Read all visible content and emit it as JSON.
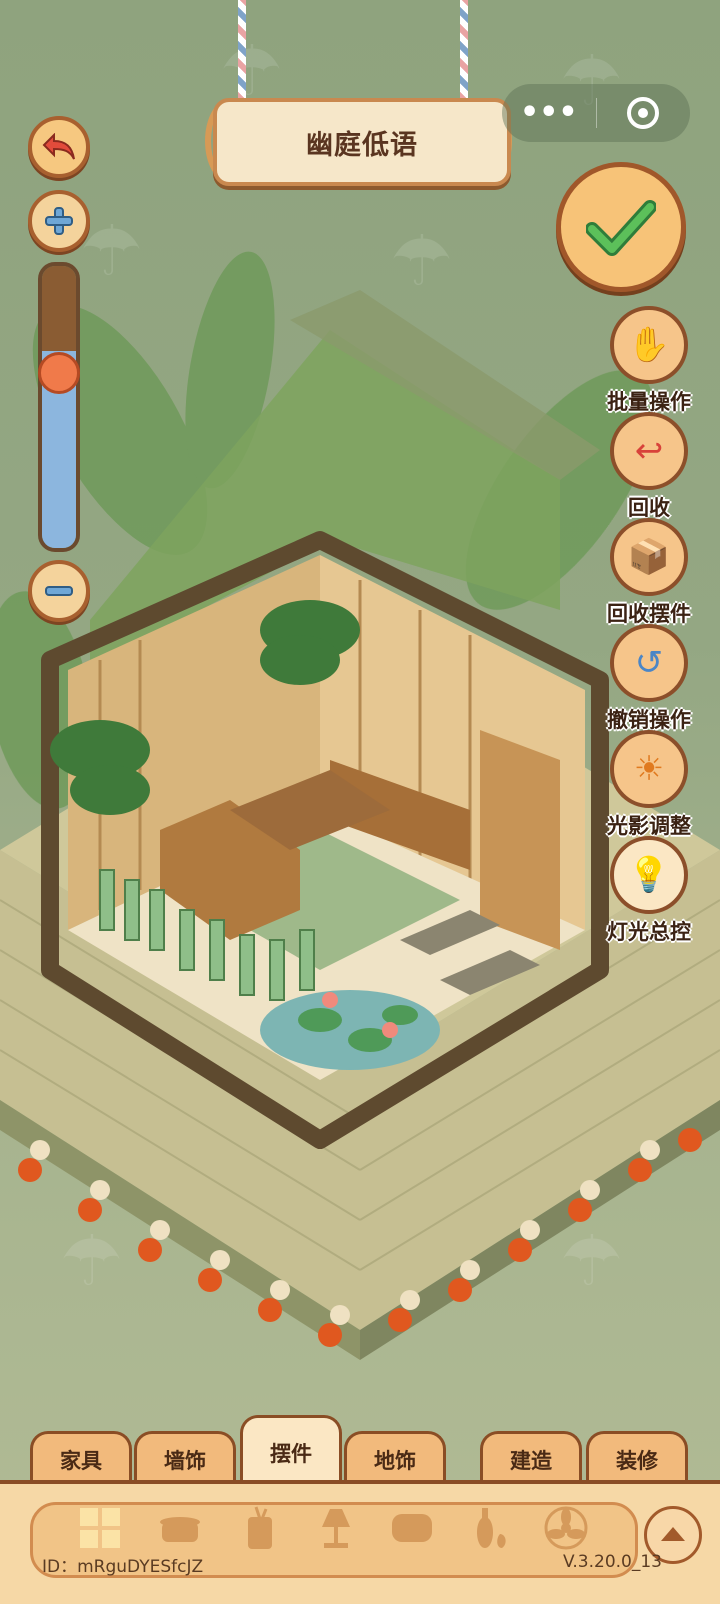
{
  "title": "幽庭低语",
  "capsule": {
    "more_label": "•••"
  },
  "zoom": {
    "level": 0.7
  },
  "right_menu": [
    {
      "key": "batch",
      "label": "批量操作",
      "icon": "hand-tap-icon"
    },
    {
      "key": "recycle",
      "label": "回收",
      "icon": "recycle-tray-icon"
    },
    {
      "key": "recycle_items",
      "label": "回收摆件",
      "icon": "recycle-box-icon"
    },
    {
      "key": "undo",
      "label": "撤销操作",
      "icon": "undo-arrow-icon"
    },
    {
      "key": "light_shadow",
      "label": "光影调整",
      "icon": "sun-moon-icon"
    },
    {
      "key": "lighting",
      "label": "灯光总控",
      "icon": "lightbulb-icon"
    }
  ],
  "tabs": [
    {
      "label": "家具",
      "active": false
    },
    {
      "label": "墙饰",
      "active": false
    },
    {
      "label": "摆件",
      "active": true
    },
    {
      "label": "地饰",
      "active": false
    },
    {
      "label": "建造",
      "active": false
    },
    {
      "label": "装修",
      "active": false
    }
  ],
  "categories": [
    "grid-icon",
    "pot-icon",
    "cup-icon",
    "lamp-icon",
    "pillow-icon",
    "vase-icon",
    "fan-icon"
  ],
  "footer": {
    "id_text": "ID：mRguDYESfcJZ",
    "version": "V.3.20.0_13"
  },
  "colors": {
    "accent": "#f2ba7c",
    "border": "#8a4d25",
    "confirm": "#3b9a4a"
  }
}
